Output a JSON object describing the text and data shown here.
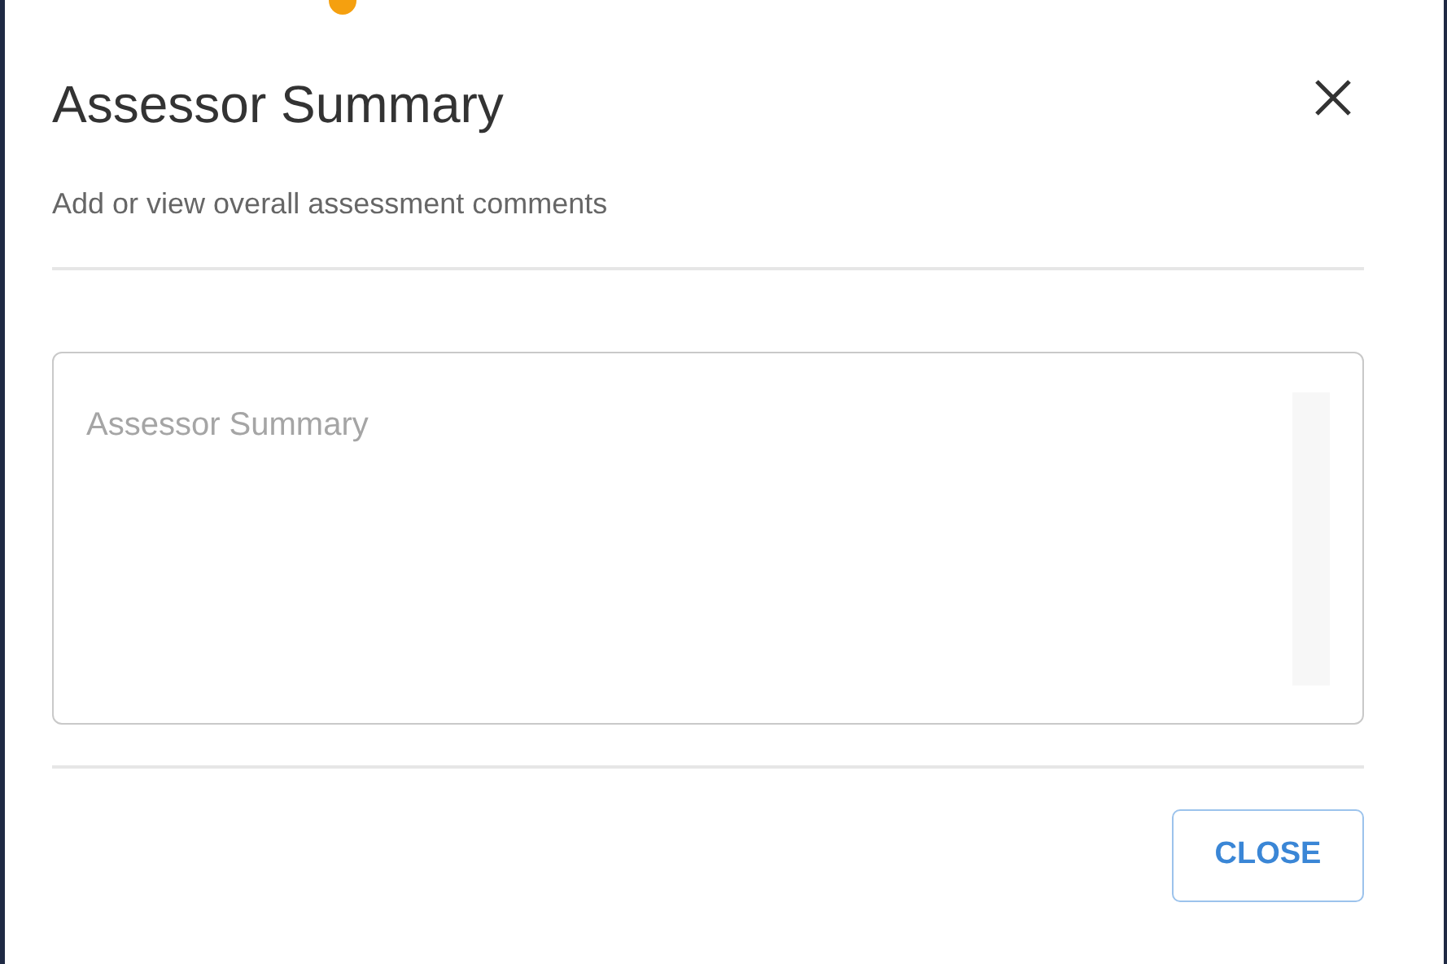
{
  "dialog": {
    "title": "Assessor Summary",
    "subtitle": "Add or view overall assessment comments"
  },
  "summary_field": {
    "placeholder": "Assessor Summary"
  },
  "buttons": [
    {
      "label": "CLOSE"
    }
  ]
}
